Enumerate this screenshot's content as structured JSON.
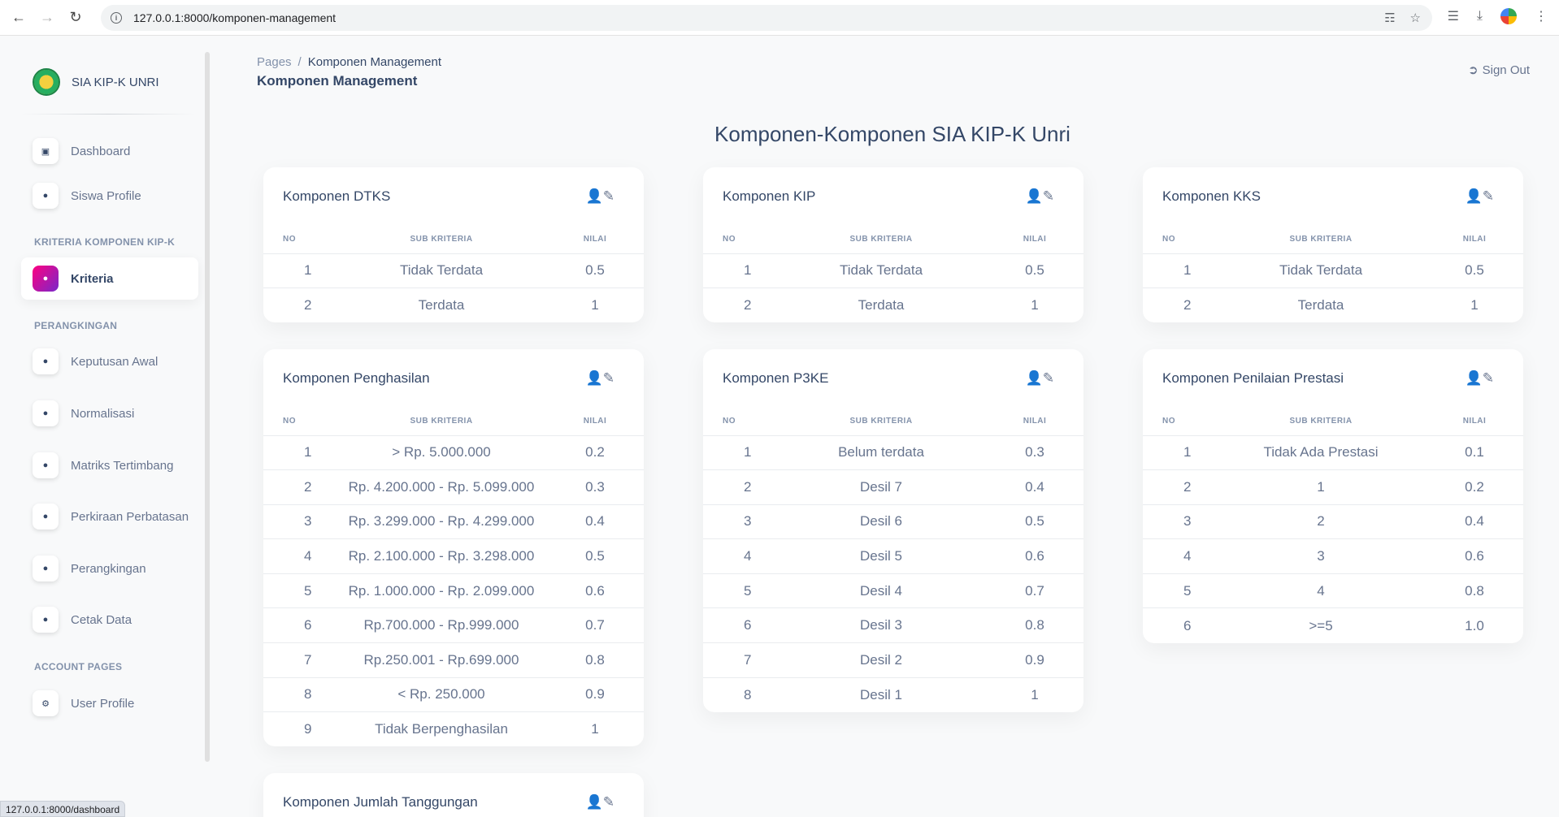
{
  "browser": {
    "url": "127.0.0.1:8000/komponen-management",
    "status_url": "127.0.0.1:8000/dashboard"
  },
  "sidebar": {
    "brand": "SIA KIP-K UNRI",
    "items": [
      {
        "label": "Dashboard",
        "icon": "dashboard-icon"
      },
      {
        "label": "Siswa Profile",
        "icon": "user-icon"
      }
    ],
    "section_kriteria": "KRITERIA KOMPONEN KIP-K",
    "kriteria_item": {
      "label": "Kriteria",
      "icon": "user-icon"
    },
    "section_perangkingan": "PERANGKINGAN",
    "perangkingan_items": [
      {
        "label": "Keputusan Awal"
      },
      {
        "label": "Normalisasi"
      },
      {
        "label": "Matriks Tertimbang"
      },
      {
        "label": "Perkiraan Perbatasan"
      },
      {
        "label": "Perangkingan"
      },
      {
        "label": "Cetak Data"
      }
    ],
    "section_account": "ACCOUNT PAGES",
    "account_item": {
      "label": "User Profile",
      "icon": "gears-icon"
    }
  },
  "header": {
    "breadcrumb_root": "Pages",
    "breadcrumb_sep": "/",
    "breadcrumb_current": "Komponen Management",
    "page_title": "Komponen Management",
    "sign_out": "Sign Out"
  },
  "main": {
    "heading": "Komponen-Komponen SIA KIP-K Unri",
    "col_no": "NO",
    "col_sub": "SUB KRITERIA",
    "col_nilai": "NILAI",
    "cards": [
      {
        "title": "Komponen DTKS",
        "rows": [
          [
            "1",
            "Tidak Terdata",
            "0.5"
          ],
          [
            "2",
            "Terdata",
            "1"
          ]
        ]
      },
      {
        "title": "Komponen KIP",
        "rows": [
          [
            "1",
            "Tidak Terdata",
            "0.5"
          ],
          [
            "2",
            "Terdata",
            "1"
          ]
        ]
      },
      {
        "title": "Komponen KKS",
        "rows": [
          [
            "1",
            "Tidak Terdata",
            "0.5"
          ],
          [
            "2",
            "Terdata",
            "1"
          ]
        ]
      },
      {
        "title": "Komponen Penghasilan",
        "rows": [
          [
            "1",
            "> Rp. 5.000.000",
            "0.2"
          ],
          [
            "2",
            "Rp. 4.200.000 - Rp. 5.099.000",
            "0.3"
          ],
          [
            "3",
            "Rp. 3.299.000 - Rp. 4.299.000",
            "0.4"
          ],
          [
            "4",
            "Rp. 2.100.000 - Rp. 3.298.000",
            "0.5"
          ],
          [
            "5",
            "Rp. 1.000.000 - Rp. 2.099.000",
            "0.6"
          ],
          [
            "6",
            "Rp.700.000 - Rp.999.000",
            "0.7"
          ],
          [
            "7",
            "Rp.250.001 - Rp.699.000",
            "0.8"
          ],
          [
            "8",
            "< Rp. 250.000",
            "0.9"
          ],
          [
            "9",
            "Tidak Berpenghasilan",
            "1"
          ]
        ]
      },
      {
        "title": "Komponen P3KE",
        "rows": [
          [
            "1",
            "Belum terdata",
            "0.3"
          ],
          [
            "2",
            "Desil 7",
            "0.4"
          ],
          [
            "3",
            "Desil 6",
            "0.5"
          ],
          [
            "4",
            "Desil 5",
            "0.6"
          ],
          [
            "5",
            "Desil 4",
            "0.7"
          ],
          [
            "6",
            "Desil 3",
            "0.8"
          ],
          [
            "7",
            "Desil 2",
            "0.9"
          ],
          [
            "8",
            "Desil 1",
            "1"
          ]
        ]
      },
      {
        "title": "Komponen Penilaian Prestasi",
        "rows": [
          [
            "1",
            "Tidak Ada Prestasi",
            "0.1"
          ],
          [
            "2",
            "1",
            "0.2"
          ],
          [
            "3",
            "2",
            "0.4"
          ],
          [
            "4",
            "3",
            "0.6"
          ],
          [
            "5",
            "4",
            "0.8"
          ],
          [
            "6",
            ">=5",
            "1.0"
          ]
        ]
      },
      {
        "title": "Komponen Jumlah Tanggungan",
        "rows": []
      }
    ]
  }
}
